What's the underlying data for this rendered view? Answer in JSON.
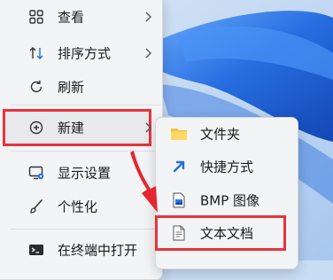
{
  "context_menu": {
    "items": [
      {
        "label": "查看",
        "icon": "grid-view-icon",
        "submenu": true
      },
      {
        "label": "排序方式",
        "icon": "sort-arrows-icon",
        "submenu": true
      },
      {
        "label": "刷新",
        "icon": "refresh-icon",
        "submenu": false
      },
      {
        "label": "新建",
        "icon": "plus-circle-icon",
        "submenu": true
      },
      {
        "label": "显示设置",
        "icon": "display-settings-icon",
        "submenu": false
      },
      {
        "label": "个性化",
        "icon": "brush-icon",
        "submenu": false
      },
      {
        "label": "在终端中打开",
        "icon": "terminal-icon",
        "submenu": false
      }
    ]
  },
  "new_submenu": {
    "items": [
      {
        "label": "文件夹",
        "icon": "folder-icon"
      },
      {
        "label": "快捷方式",
        "icon": "shortcut-icon"
      },
      {
        "label": "BMP 图像",
        "icon": "bmp-image-icon"
      },
      {
        "label": "文本文档",
        "icon": "text-document-icon"
      }
    ]
  },
  "colors": {
    "highlight_border": "#e7333b",
    "menu_background": "#f3f4f6",
    "wallpaper_blue": "#2f7de8"
  }
}
